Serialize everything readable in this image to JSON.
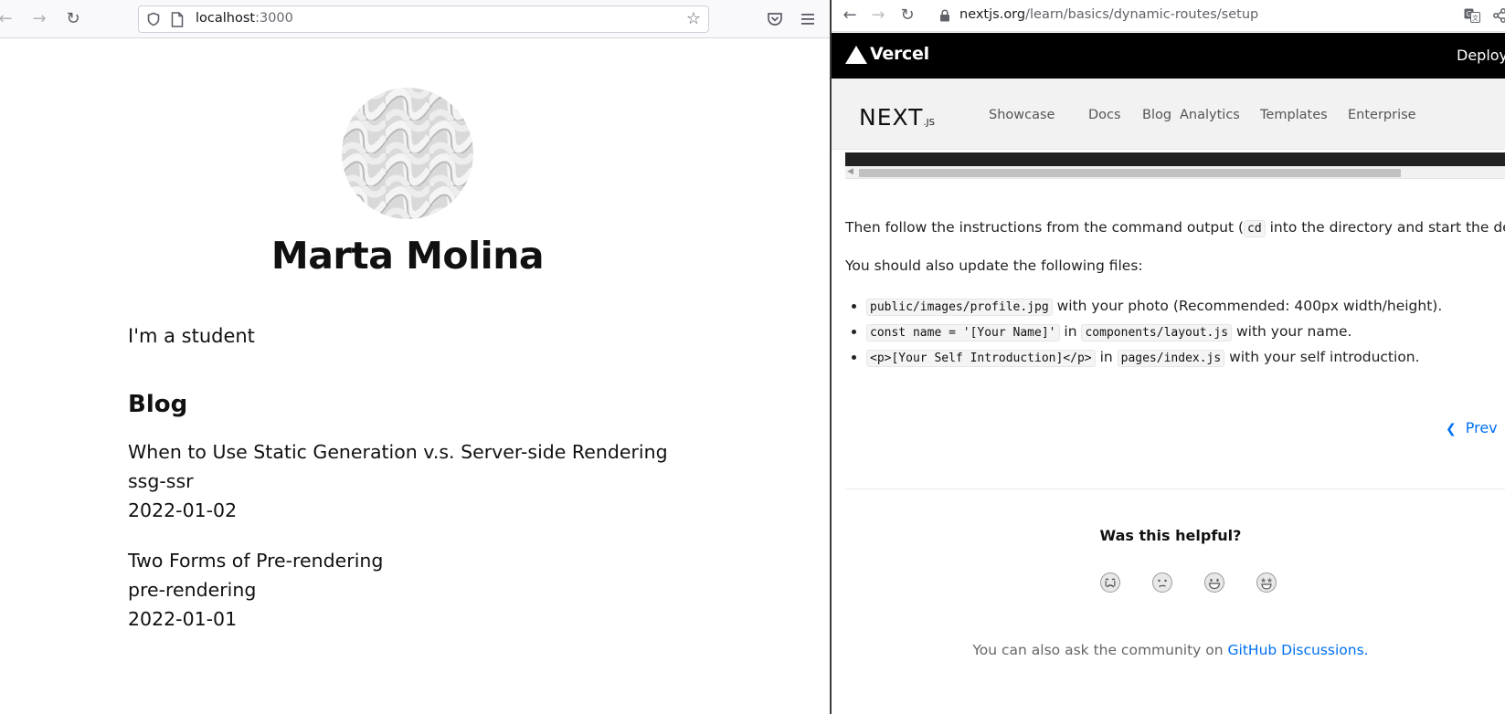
{
  "left_browser": {
    "url_host": "localhost",
    "url_port": ":3000",
    "page": {
      "name": "Marta Molina",
      "intro": "I'm a student",
      "blog_heading": "Blog",
      "posts": [
        {
          "title": "When to Use Static Generation v.s. Server-side Rendering",
          "id": "ssg-ssr",
          "date": "2022-01-02"
        },
        {
          "title": "Two Forms of Pre-rendering",
          "id": "pre-rendering",
          "date": "2022-01-01"
        }
      ]
    }
  },
  "right_browser": {
    "url_host": "nextjs.org",
    "url_path": "/learn/basics/dynamic-routes/setup",
    "vercel": {
      "brand": "Vercel",
      "deploy": "Deploy"
    },
    "next_nav": {
      "logo_main": "NEXT",
      "logo_sub": ".JS",
      "items": [
        "Showcase",
        "Docs",
        "Blog",
        "Analytics",
        "Templates",
        "Enterprise"
      ]
    },
    "content": {
      "para1_prefix": "Then follow the instructions from the command output (",
      "para1_code": "cd",
      "para1_suffix": " into the directory and start the deve",
      "para2": "You should also update the following files:",
      "bullets": [
        {
          "code1": "public/images/profile.jpg",
          "text1": " with your photo (Recommended: 400px width/height).",
          "mid": "",
          "code2": "",
          "text2": ""
        },
        {
          "code1": "const name = '[Your Name]'",
          "text1": " in ",
          "mid": "",
          "code2": "components/layout.js",
          "text2": " with your name."
        },
        {
          "code1": "<p>[Your Self Introduction]</p>",
          "text1": " in ",
          "mid": "",
          "code2": "pages/index.js",
          "text2": " with your self introduction."
        }
      ],
      "prev_label": "Prev"
    },
    "feedback": {
      "question": "Was this helpful?",
      "emojis": [
        "crying-face-icon",
        "confused-face-icon",
        "grinning-face-icon",
        "star-struck-face-icon"
      ],
      "community_prefix": "You can also ask the community on ",
      "community_link": "GitHub Discussions",
      "community_suffix": "."
    }
  }
}
